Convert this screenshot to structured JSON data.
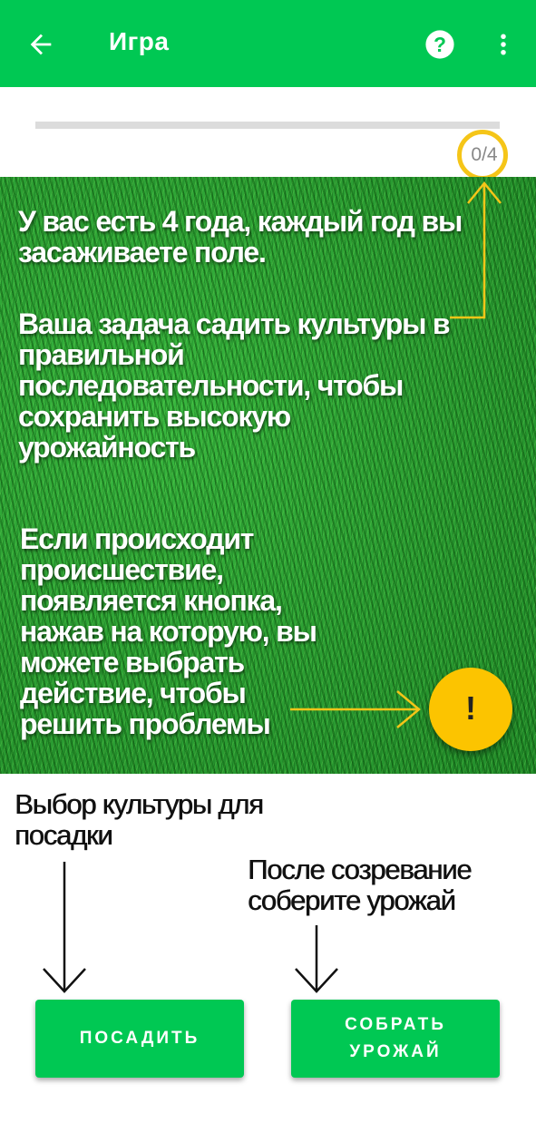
{
  "app_bar": {
    "title": "Игра",
    "back_icon": "arrow-left-icon",
    "help_icon": "question-circle-icon",
    "more_icon": "more-vert-icon",
    "background": "#00c853"
  },
  "progress": {
    "label": "0/4",
    "value": 0,
    "max": 4,
    "highlight_color": "#f5c518"
  },
  "tutorial": {
    "text_1": "У вас есть 4 года, каждый год вы засаживаете поле.",
    "text_2": "Ваша задача садить культуры в правильной последовательности, чтобы сохранить высокую урожайность",
    "text_3": "Если происходит происшествие, появляется кнопка, нажав на которую, вы можете выбрать действие, чтобы решить проблемы",
    "label_plant": "Выбор культуры для посадки",
    "label_harvest": "После созревание соберите урожай"
  },
  "fab": {
    "glyph": "!",
    "icon": "exclamation-icon",
    "color": "#fcc400"
  },
  "buttons": {
    "plant": "ПОСАДИТЬ",
    "harvest": "СОБРАТЬ УРОЖАЙ",
    "color": "#00c853"
  }
}
